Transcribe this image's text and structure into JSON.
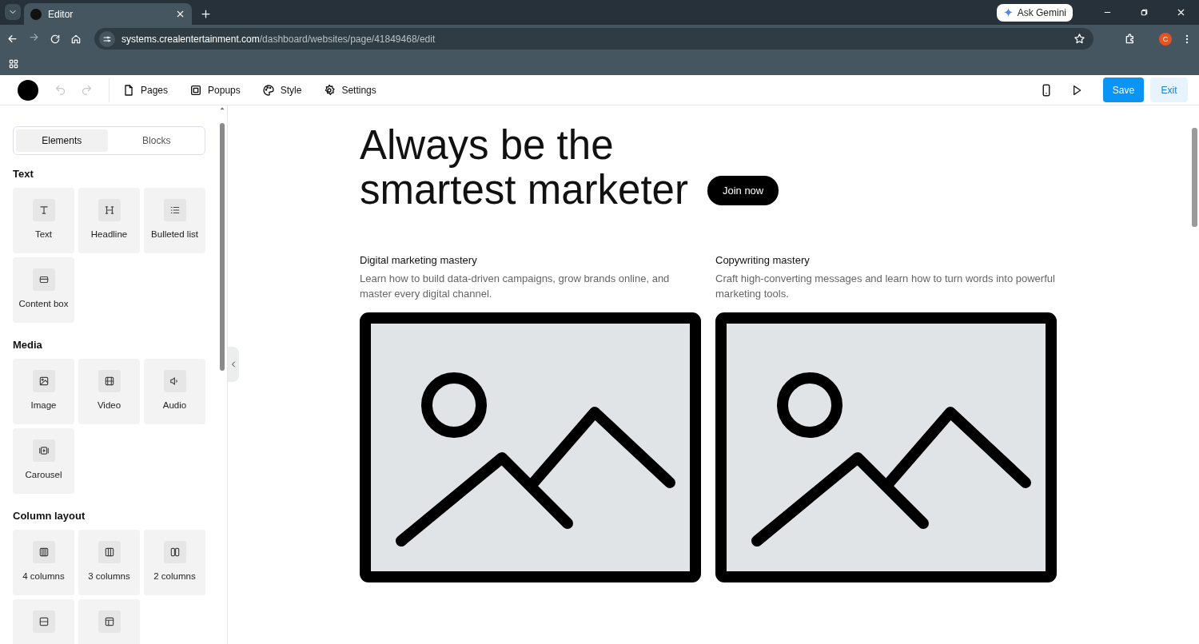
{
  "browser": {
    "tab_title": "Editor",
    "url_host": "systems.crealentertainment.com",
    "url_path": "/dashboard/websites/page/41849468/edit",
    "gemini_label": "Ask Gemini",
    "profile_initial": "C"
  },
  "toolbar": {
    "menu": [
      {
        "label": "Pages",
        "kind": "page"
      },
      {
        "label": "Popups",
        "kind": "popup"
      },
      {
        "label": "Style",
        "kind": "palette"
      },
      {
        "label": "Settings",
        "kind": "gear"
      }
    ],
    "save": "Save",
    "exit": "Exit"
  },
  "sidebar": {
    "tabs": [
      {
        "label": "Elements",
        "selected": true
      },
      {
        "label": "Blocks",
        "selected": false
      }
    ],
    "sections": [
      {
        "title": "Text",
        "items": [
          {
            "label": "Text",
            "kind": "text"
          },
          {
            "label": "Headline",
            "kind": "headline"
          },
          {
            "label": "Bulleted list",
            "kind": "list"
          },
          {
            "label": "Content box",
            "kind": "box"
          }
        ]
      },
      {
        "title": "Media",
        "items": [
          {
            "label": "Image",
            "kind": "image"
          },
          {
            "label": "Video",
            "kind": "video"
          },
          {
            "label": "Audio",
            "kind": "audio"
          },
          {
            "label": "Carousel",
            "kind": "carousel"
          }
        ]
      },
      {
        "title": "Column layout",
        "items": [
          {
            "label": "4 columns",
            "kind": "cols4"
          },
          {
            "label": "3 columns",
            "kind": "cols3"
          },
          {
            "label": "2 columns",
            "kind": "cols2"
          },
          {
            "kind": "rows"
          },
          {
            "kind": "layout"
          }
        ]
      }
    ]
  },
  "canvas": {
    "heading": "Always be the\nsmartest marketer",
    "cta": "Join now",
    "cards": [
      {
        "title": "Digital marketing mastery",
        "text": "Learn how to build data-driven campaigns, grow brands online, and master every digital channel."
      },
      {
        "title": "Copywriting mastery",
        "text": "Craft high-converting messages and learn how to turn words into powerful marketing tools."
      }
    ]
  }
}
